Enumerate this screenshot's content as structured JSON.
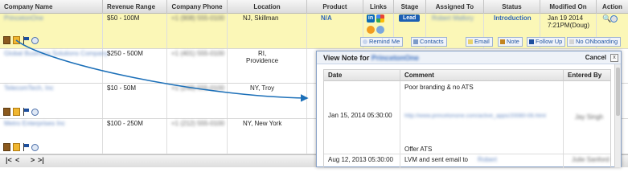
{
  "columns": {
    "company_name": "Company Name",
    "revenue_range": "Revenue Range",
    "company_phone": "Company Phone",
    "location": "Location",
    "product": "Product",
    "links": "Links",
    "stage": "Stage",
    "assigned_to": "Assigned To",
    "status": "Status",
    "modified_on": "Modified On",
    "action": "Action"
  },
  "rows": [
    {
      "company": "PrincetonOne",
      "revenue": "$50 - 100M",
      "phone": "+1 (908) 555-0100",
      "location_line1": "NJ, Skillman",
      "location_line2": "",
      "product": "N/A",
      "stage": "Lead",
      "assigned_to": "Robert Mallory",
      "status": "Introduction",
      "modified_line1": "Jan 19 2014",
      "modified_line2": "7:21PM(Doug)"
    },
    {
      "company": "Global Business Solutions Company",
      "revenue": "$250 - 500M",
      "phone": "+1 (401) 555-0100",
      "location_line1": "RI,",
      "location_line2": "Providence"
    },
    {
      "company": "TelecomTech, Inc",
      "revenue": "$10 - 50M",
      "phone": "+1 (248) 555-0100",
      "location_line1": "NY, Troy",
      "location_line2": ""
    },
    {
      "company": "Metro Enterprises Inc",
      "revenue": "$100 - 250M",
      "phone": "+1 (212) 555-0100",
      "location_line1": "NY, New York",
      "location_line2": ""
    }
  ],
  "action_buttons": {
    "remind_me": "Remind Me",
    "contacts": "Contacts",
    "email": "Email",
    "note": "Note",
    "follow_up": "Follow Up",
    "no_onboarding": "No ONboarding"
  },
  "links_icons": [
    "linkedin-icon",
    "google-plus-icon",
    "skype-icon",
    "chat-icon"
  ],
  "pager": {
    "first": "|<",
    "prev": "<",
    "next": ">",
    "last": ">|"
  },
  "popup": {
    "title": "View Note for",
    "company": "PrincetonOne",
    "cancel": "Cancel",
    "close": "x",
    "headers": {
      "date": "Date",
      "comment": "Comment",
      "entered_by": "Entered By"
    },
    "notes": [
      {
        "date": "Jan 15, 2014 05:30:00",
        "comment_line1": "Poor branding & no ATS",
        "comment_link": "http://www.princetonone.com/active_apps/20080-06.html",
        "comment_line3": "Offer ATS",
        "entered_by": "Jay Singh"
      },
      {
        "date": "Aug 12, 2013 05:30:00",
        "comment_line1": "LVM and sent email to",
        "comment_blur": "Robert",
        "entered_by": "Julie Sanford"
      }
    ]
  },
  "colors": {
    "highlight_row": "#fbf7b7",
    "link_blue": "#2e64b8",
    "arrow": "#1b6fb8",
    "lead_badge": "#1c5fb3"
  }
}
